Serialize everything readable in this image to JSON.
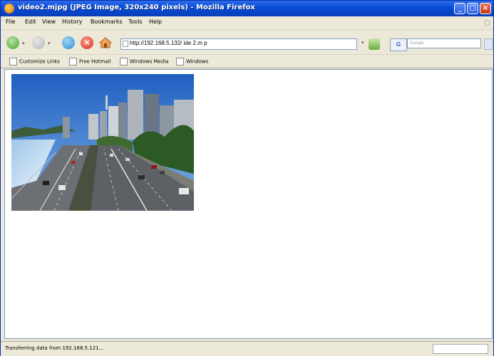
{
  "window": {
    "title": "video2.mjpg (JPEG Image, 320x240 pixels) - Mozilla Firefox",
    "controls": [
      "minimize",
      "maximize",
      "close"
    ]
  },
  "menu": [
    "File",
    "Edit",
    "View",
    "History",
    "Bookmarks",
    "Tools",
    "Help"
  ],
  "toolbar": {
    "url": "http://192.168.5.132/ ide 2.m p",
    "search_placeholder": "Google",
    "search_engine": "G"
  },
  "bookmarks": [
    "Customize Links",
    "Free Hotmail",
    "Windows Media",
    "Windows"
  ],
  "content": {
    "image": "video-frame"
  },
  "status": {
    "text": "Transferring data from 192.168.5.121..."
  }
}
